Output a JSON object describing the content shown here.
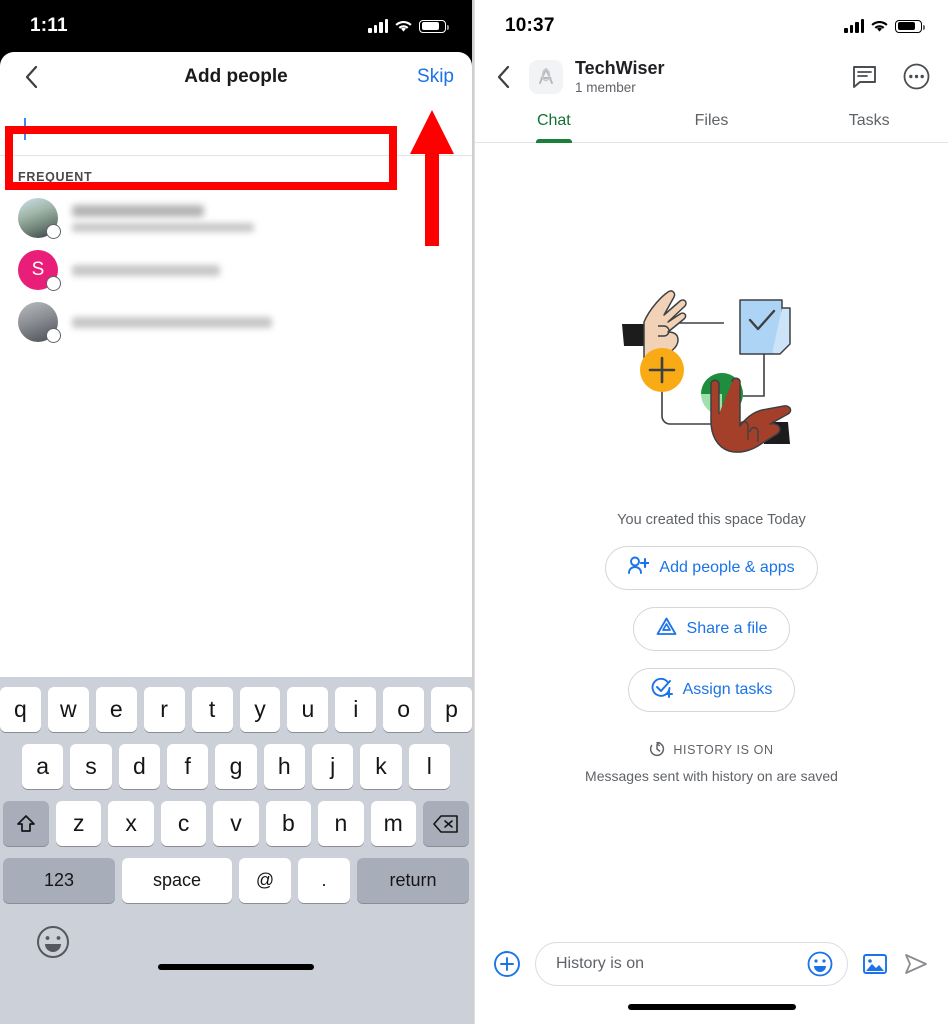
{
  "left_screen": {
    "status_bar": {
      "time": "1:11",
      "signal_icon": "cellular-bars-icon",
      "wifi_icon": "wifi-icon",
      "battery_icon": "battery-icon"
    },
    "sheet": {
      "back_icon": "back-chevron-icon",
      "title": "Add people",
      "skip_label": "Skip",
      "search_value": "",
      "search_placeholder": "",
      "section_label": "FREQUENT"
    },
    "contacts": [
      {
        "avatar_type": "photo",
        "avatar_initial": "",
        "name": "",
        "email": "",
        "name_width": 132,
        "email_width": 182
      },
      {
        "avatar_type": "initial",
        "avatar_initial": "S",
        "name": "",
        "email": "",
        "name_width": 0,
        "email_width": 148
      },
      {
        "avatar_type": "photo",
        "avatar_initial": "",
        "name": "",
        "email": "",
        "name_width": 0,
        "email_width": 200
      }
    ],
    "annotation": {
      "box_color": "#ff0000",
      "arrow_color": "#ff0000",
      "points_to": "Skip"
    },
    "keyboard": {
      "row1": [
        "q",
        "w",
        "e",
        "r",
        "t",
        "y",
        "u",
        "i",
        "o",
        "p"
      ],
      "row2": [
        "a",
        "s",
        "d",
        "f",
        "g",
        "h",
        "j",
        "k",
        "l"
      ],
      "row3": [
        "z",
        "x",
        "c",
        "v",
        "b",
        "n",
        "m"
      ],
      "shift_icon": "shift-up-arrow-icon",
      "backspace_icon": "backspace-delete-icon",
      "numbers_label": "123",
      "space_label": "space",
      "at_label": "@",
      "period_label": ".",
      "return_label": "return",
      "emoji_icon": "emoji-smiley-icon"
    }
  },
  "right_screen": {
    "status_bar": {
      "time": "10:37",
      "signal_icon": "cellular-bars-icon",
      "wifi_icon": "wifi-icon",
      "battery_icon": "battery-icon"
    },
    "header": {
      "back_icon": "back-chevron-icon",
      "space_icon": "space-avatar-icon",
      "space_name": "TechWiser",
      "member_count": "1 member",
      "chat_icon": "message-bubble-icon",
      "more_icon": "more-options-icon"
    },
    "tabs": [
      {
        "label": "Chat",
        "active": true
      },
      {
        "label": "Files",
        "active": false
      },
      {
        "label": "Tasks",
        "active": false
      }
    ],
    "empty_state": {
      "illustration": "hands-collaboration-illustration",
      "created_text": "You created this space Today",
      "actions": [
        {
          "label": "Add people & apps",
          "icon": "add-person-icon"
        },
        {
          "label": "Share a file",
          "icon": "drive-file-icon"
        },
        {
          "label": "Assign tasks",
          "icon": "task-check-icon"
        }
      ]
    },
    "history": {
      "icon": "history-clock-icon",
      "status_label": "HISTORY IS ON",
      "description": "Messages sent with history on are saved"
    },
    "composer": {
      "plus_icon": "add-attachment-icon",
      "placeholder": "History is on",
      "value": "",
      "emoji_icon": "emoji-smiley-icon",
      "image_icon": "image-picker-icon",
      "send_icon": "send-arrow-icon"
    }
  },
  "colors": {
    "accent_blue": "#1a73e8",
    "active_green": "#137333",
    "tab_indicator_green": "#188038",
    "annotation_red": "#ff0000",
    "avatar_pink": "#e91e78",
    "text_secondary": "#5f6368"
  }
}
